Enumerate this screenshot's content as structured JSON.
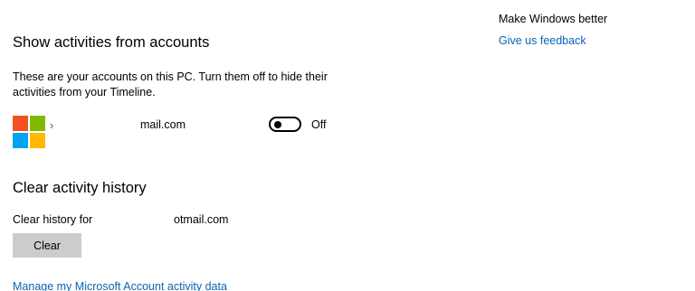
{
  "accounts_section": {
    "title": "Show activities from accounts",
    "description": "These are your accounts on this PC. Turn them off to hide their activities from your Timeline.",
    "account": {
      "logo": "microsoft-logo",
      "prefix": "›",
      "email": "mail.com",
      "toggle_state": "Off",
      "toggle_on": false
    }
  },
  "clear_section": {
    "title": "Clear activity history",
    "clear_for_label": "Clear history for",
    "clear_for_email": "otmail.com",
    "clear_button_label": "Clear",
    "manage_link": "Manage my Microsoft Account activity data"
  },
  "side_panel": {
    "heading": "Make Windows better",
    "feedback_link": "Give us feedback"
  },
  "colors": {
    "link": "#0a64b4",
    "button_bg": "#cccccc",
    "ms_red": "#f25022",
    "ms_green": "#7fba00",
    "ms_blue": "#00a4ef",
    "ms_yellow": "#ffb900"
  }
}
